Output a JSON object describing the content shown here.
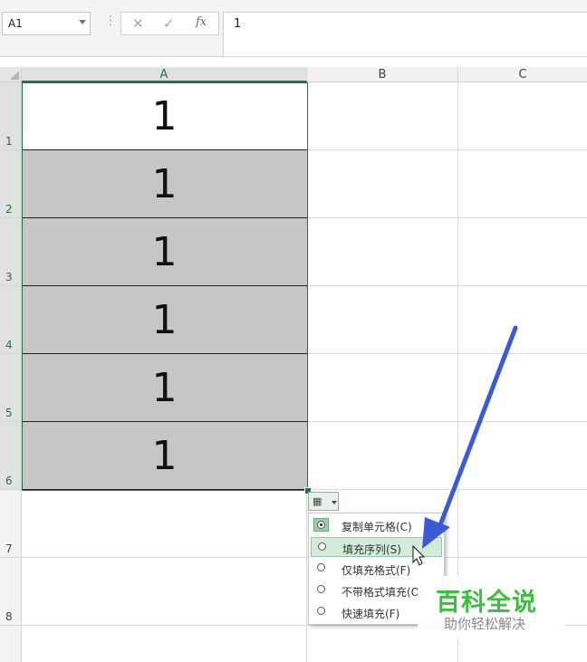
{
  "formula_bar": {
    "name_box": "A1",
    "separator": "⋮",
    "cancel_symbol": "✕",
    "enter_symbol": "✓",
    "fx_label": "fx",
    "formula_value": "1"
  },
  "columns": [
    "A",
    "B",
    "C"
  ],
  "rows": [
    "1",
    "2",
    "3",
    "4",
    "5",
    "6",
    "7",
    "8"
  ],
  "cells_a": [
    "1",
    "1",
    "1",
    "1",
    "1",
    "1"
  ],
  "autofill_menu": {
    "items": [
      {
        "label": "复制单元格(C)",
        "selected": true
      },
      {
        "label": "填充序列(S)",
        "hovered": true
      },
      {
        "label": "仅填充格式(F)"
      },
      {
        "label": "不带格式填充(O)"
      },
      {
        "label": "快速填充(F)"
      }
    ]
  },
  "watermark": {
    "title": "百科全说",
    "subtitle": "助你轻松解决"
  },
  "colors": {
    "selection_green": "#217346",
    "selected_cell_fill": "#c6c6c6",
    "annotation_arrow": "#3b5bd6"
  }
}
